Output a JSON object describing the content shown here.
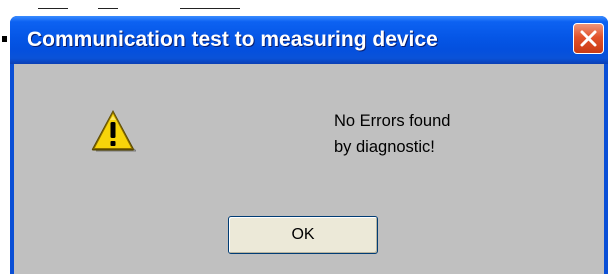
{
  "dialog": {
    "title": "Communication test to measuring device",
    "close_icon": "close-icon",
    "warning_icon": "warning-icon",
    "message_line_1": "No Errors found",
    "message_line_2": "by diagnostic!",
    "ok_label": "OK"
  },
  "colors": {
    "titlebar": "#0556e6",
    "body": "#c0c0c0",
    "close_button": "#e2532c",
    "button_face": "#ece9d8",
    "warning_fill": "#f7d40a"
  }
}
